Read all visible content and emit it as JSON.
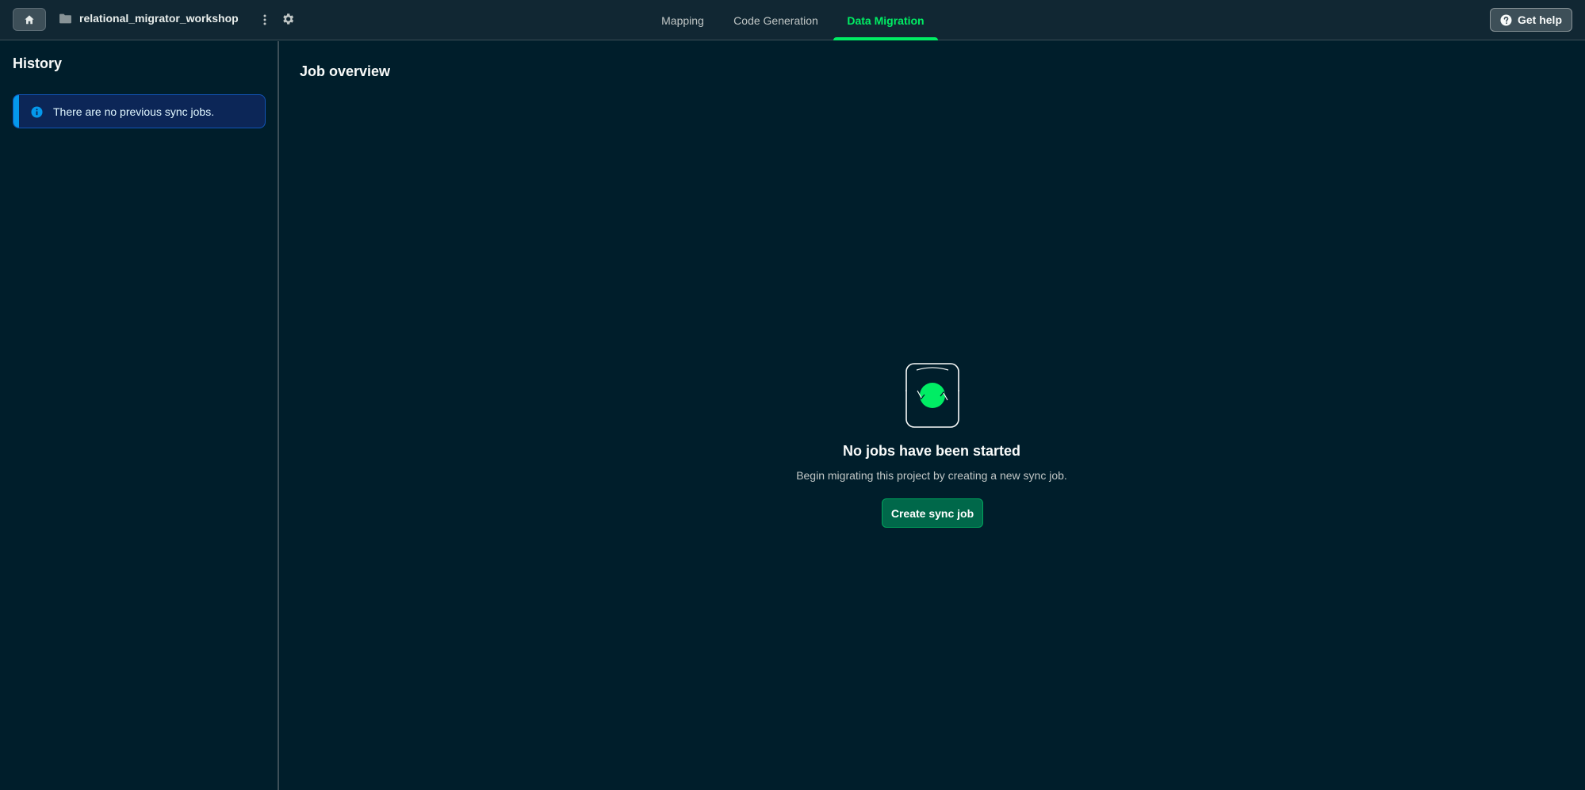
{
  "header": {
    "project_name": "relational_migrator_workshop",
    "tabs": [
      {
        "label": "Mapping",
        "active": false
      },
      {
        "label": "Code Generation",
        "active": false
      },
      {
        "label": "Data Migration",
        "active": true
      }
    ],
    "help_label": "Get help"
  },
  "sidebar": {
    "title": "History",
    "banner_text": "There are no previous sync jobs."
  },
  "main": {
    "title": "Job overview",
    "empty_title": "No jobs have been started",
    "empty_description": "Begin migrating this project by creating a new sync job.",
    "create_button_label": "Create sync job"
  },
  "icons": [
    "home-icon",
    "folder-icon",
    "more-vertical-icon",
    "settings-gear-icon",
    "help-circle-icon",
    "info-icon",
    "sync-illustration"
  ],
  "colors": {
    "background": "#001e2b",
    "topbar": "#112733",
    "accent_green": "#00ed64",
    "button_green": "#00684a",
    "info_blue": "#0498ec"
  }
}
